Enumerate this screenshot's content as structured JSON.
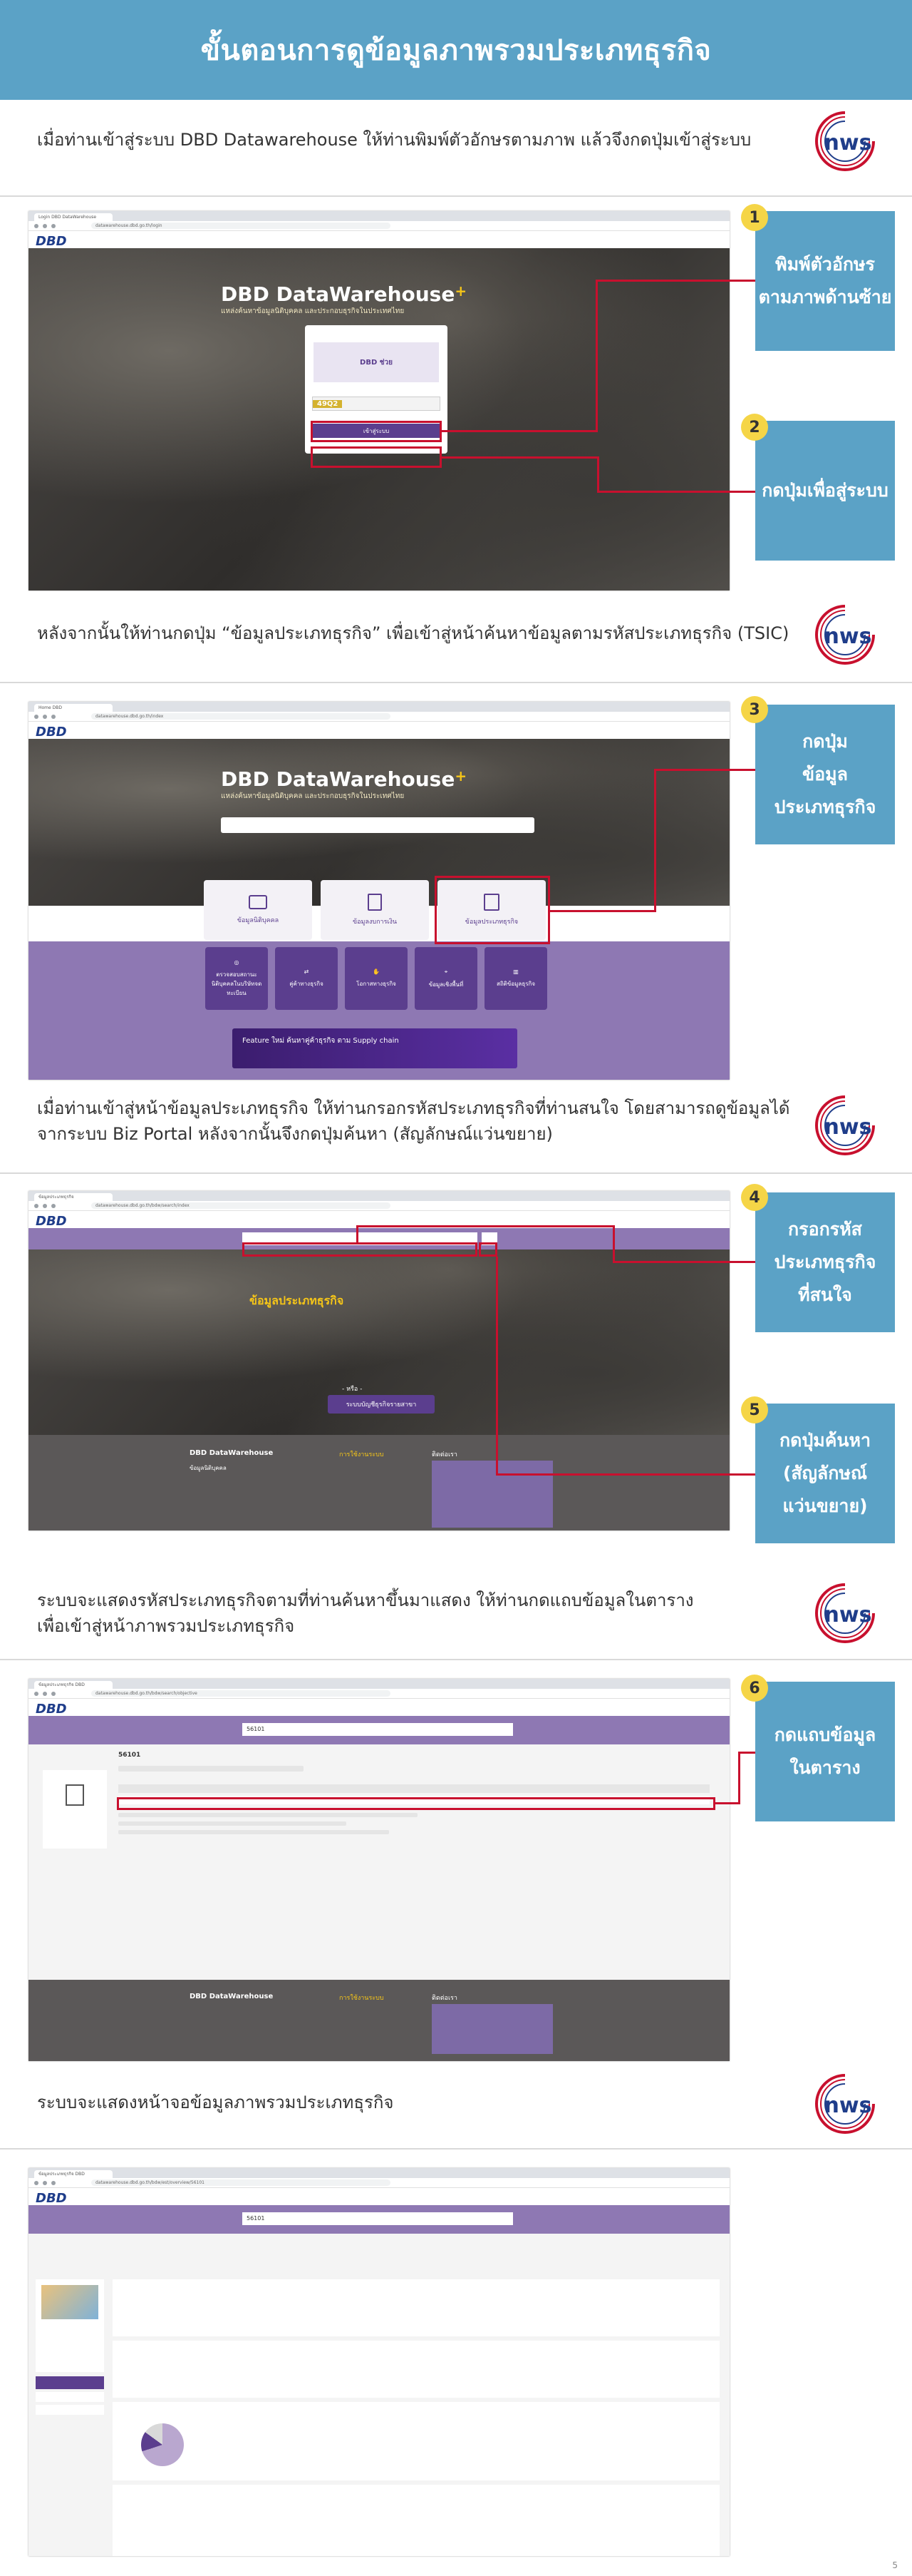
{
  "header": {
    "title": "ขั้นตอนการดูข้อมูลภาพรวมประเภทธุรกิจ"
  },
  "logo": {
    "text": "nws"
  },
  "sections": [
    {
      "caption": "เมื่อท่านเข้าสู่ระบบ DBD Datawarehouse ให้ท่านพิมพ์ตัวอักษรตามภาพ แล้วจึงกดปุ่มเข้าสู่ระบบ"
    },
    {
      "caption": "หลังจากนั้นให้ท่านกดปุ่ม “ข้อมูลประเภทธุรกิจ” เพื่อเข้าสู่หน้าค้นหาข้อมูลตามรหัสประเภทธุรกิจ (TSIC)"
    },
    {
      "caption_line1": "เมื่อท่านเข้าสู่หน้าข้อมูลประเภทธุรกิจ ให้ท่านกรอกรหัสประเภทธุรกิจที่ท่านสนใจ โดยสามารถดูข้อมูลได้",
      "caption_line2": "จากระบบ Biz Portal หลังจากนั้นจึงกดปุ่มค้นหา (สัญลักษณ์แว่นขยาย)"
    },
    {
      "caption_line1": "ระบบจะแสดงรหัสประเภทธุรกิจตามที่ท่านค้นหาขึ้นมาแสดง ให้ท่านกดแถบข้อมูลในตาราง",
      "caption_line2": "เพื่อเข้าสู่หน้าภาพรวมประเภทธุรกิจ"
    },
    {
      "caption": "ระบบจะแสดงหน้าจอข้อมูลภาพรวมประเภทธุรกิจ"
    }
  ],
  "steps": [
    {
      "num": "1",
      "lines": [
        "พิมพ์ตัวอักษร",
        "ตามภาพด้านซ้าย"
      ]
    },
    {
      "num": "2",
      "lines": [
        "กดปุ่มเพื่อสู่ระบบ"
      ]
    },
    {
      "num": "3",
      "lines": [
        "กดปุ่ม",
        "ข้อมูล",
        "ประเภทธุรกิจ"
      ]
    },
    {
      "num": "4",
      "lines": [
        "กรอกรหัส",
        "ประเภทธุรกิจ",
        "ที่สนใจ"
      ]
    },
    {
      "num": "5",
      "lines": [
        "กดปุ่มค้นหา",
        "(สัญลักษณ์",
        "แว่นขยาย)"
      ]
    },
    {
      "num": "6",
      "lines": [
        "กดแถบข้อมูล",
        "ในตาราง"
      ]
    }
  ],
  "screens": {
    "brand": "DBD",
    "dw_title": "DBD DataWarehouse",
    "dw_plus": "+",
    "dw_subtitle": "แหล่งค้นหาข้อมูลนิติบุคคล และประกอบธุรกิจในประเทศไทย",
    "login_button": "เข้าสู่ระบบ",
    "captcha": "49Q2",
    "home_cards": [
      "ข้อมูลนิติบุคคล",
      "ข้อมูลงบการเงิน",
      "ข้อมูลประเภทธุรกิจ"
    ],
    "home_icons": [
      "ตรวจสอบสถานะนิติบุคคลในบริษัทจดทะเบียน",
      "คู่ค้าทางธุรกิจ",
      "โอกาสทางธุรกิจ",
      "ข้อมูลเชิงพื้นที่",
      "สถิติข้อมูลธุรกิจ"
    ],
    "feature_banner": "Feature ใหม่ ค้นหาคู่ค้าธุรกิจ ตาม Supply chain",
    "biz_title": "ข้อมูลประเภทธุรกิจ",
    "or_label": "- หรือ -",
    "biz_button": "ระบบบัญชีธุรกิจรายสาขา",
    "footer_menu_1": "ข้อมูลนิติบุคคล",
    "footer_menu_2": "การใช้งานระบบ",
    "footer_menu_3": "ติดต่อเรา",
    "search_code": "56101",
    "page_number": "5"
  }
}
